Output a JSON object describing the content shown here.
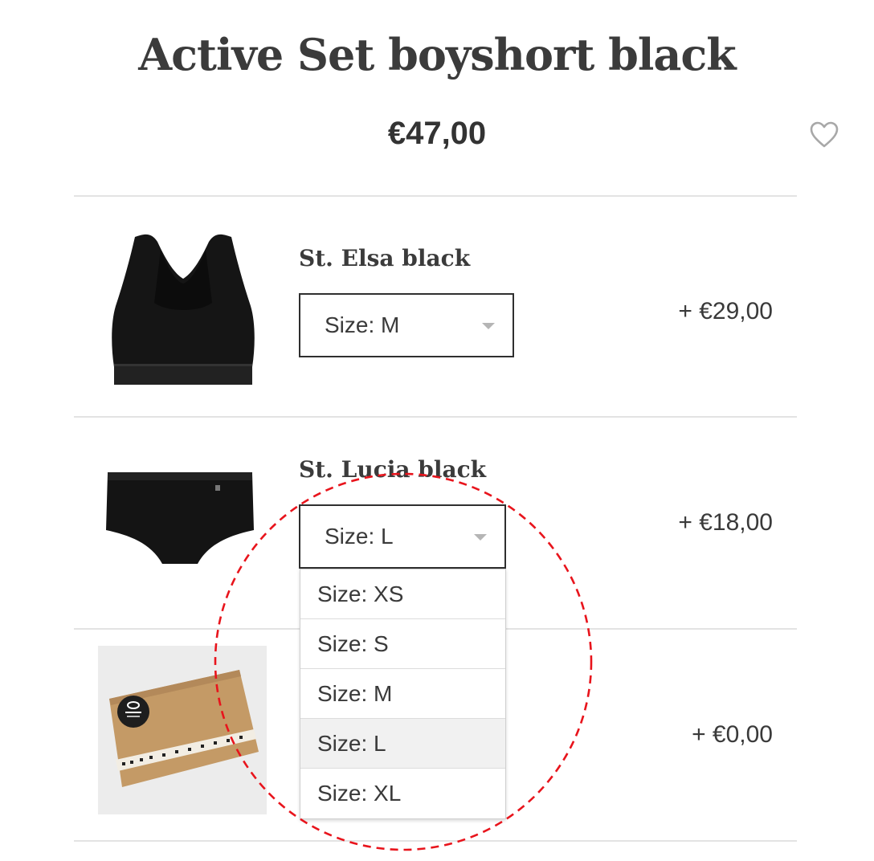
{
  "product": {
    "title": "Active Set boyshort black",
    "price": "€47,00",
    "wishlist_icon": "heart-outline-icon"
  },
  "items": [
    {
      "name": "St. Elsa black",
      "size_label": "Size: M",
      "price": "+ €29,00",
      "image": "black-sports-bra"
    },
    {
      "name": "St. Lucia black",
      "size_label": "Size: L",
      "price": "+ €18,00",
      "image": "black-boyshort"
    },
    {
      "name": "",
      "price": "+ €0,00",
      "image": "gift-box-saint-basics"
    }
  ],
  "size_dropdown": {
    "options": [
      "Size: XS",
      "Size: S",
      "Size: M",
      "Size: L",
      "Size: XL"
    ],
    "highlighted": "Size: L"
  },
  "colors": {
    "text": "#3a3a3a",
    "divider": "#e3e3e3",
    "annotation": "#e8141c",
    "highlight": "#f1f1f1"
  }
}
